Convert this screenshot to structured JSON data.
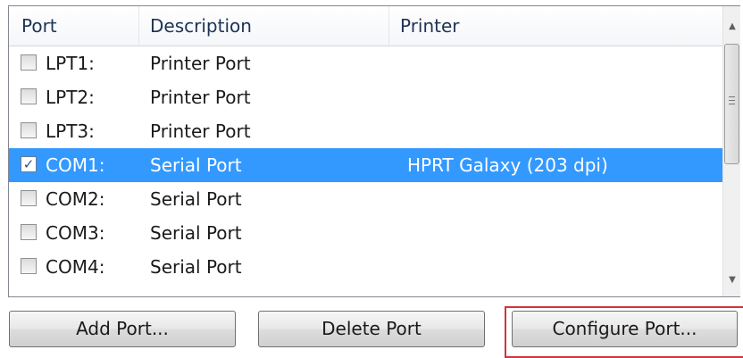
{
  "list": {
    "columns": {
      "port": "Port",
      "description": "Description",
      "printer": "Printer"
    },
    "rows": [
      {
        "checked": false,
        "port": "LPT1:",
        "description": "Printer Port",
        "printer": "",
        "selected": false
      },
      {
        "checked": false,
        "port": "LPT2:",
        "description": "Printer Port",
        "printer": "",
        "selected": false
      },
      {
        "checked": false,
        "port": "LPT3:",
        "description": "Printer Port",
        "printer": "",
        "selected": false
      },
      {
        "checked": true,
        "port": "COM1:",
        "description": "Serial Port",
        "printer": "HPRT Galaxy (203 dpi)",
        "selected": true
      },
      {
        "checked": false,
        "port": "COM2:",
        "description": "Serial Port",
        "printer": "",
        "selected": false
      },
      {
        "checked": false,
        "port": "COM3:",
        "description": "Serial Port",
        "printer": "",
        "selected": false
      },
      {
        "checked": false,
        "port": "COM4:",
        "description": "Serial Port",
        "printer": "",
        "selected": false
      }
    ],
    "selected_row_color": "#3399ff"
  },
  "buttons": {
    "add_port": "Add Port...",
    "delete_port": "Delete Port",
    "configure_port": "Configure Port..."
  },
  "highlight_color": "#d0343c",
  "icons": {
    "scroll_up": "chevron-up-icon",
    "scroll_down": "chevron-down-icon",
    "check": "checkmark-icon"
  }
}
